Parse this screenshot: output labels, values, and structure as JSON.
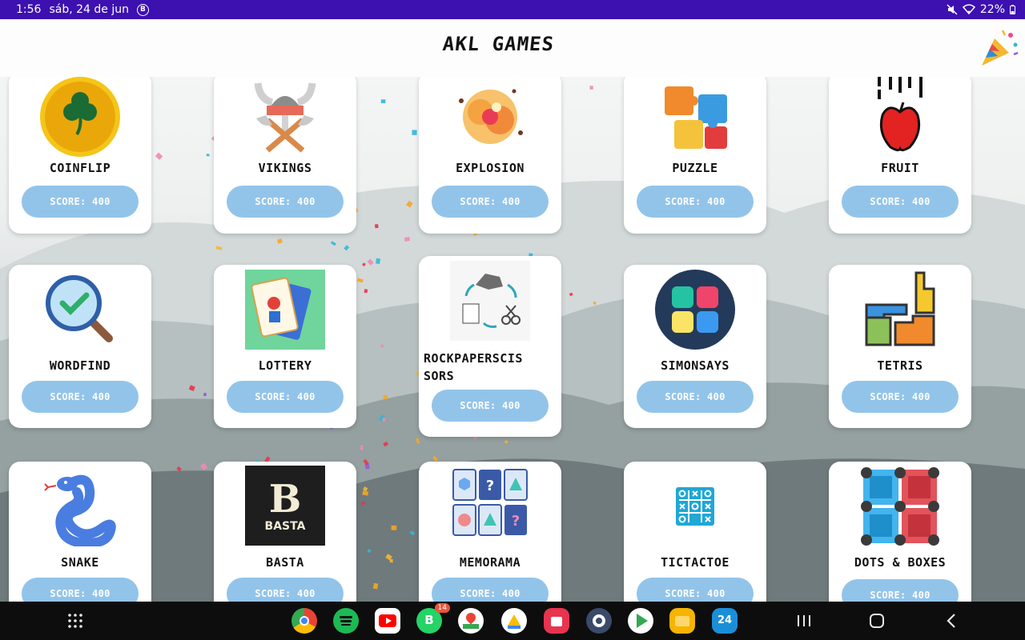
{
  "status_bar": {
    "time": "1:56",
    "date": "sáb, 24 de jun",
    "notif_letter": "B",
    "battery": "22%"
  },
  "app": {
    "title": "AKL GAMES"
  },
  "colors": {
    "status_bar_bg": "#3d10b0",
    "score_button_bg": "#92c4ea",
    "card_bg": "#ffffff"
  },
  "games": [
    {
      "name": "COINFLIP",
      "score": "SCORE: 400",
      "icon": "clover-coin-icon"
    },
    {
      "name": "VIKINGS",
      "score": "SCORE: 400",
      "icon": "viking-helmet-icon"
    },
    {
      "name": "EXPLOSION",
      "score": "SCORE: 400",
      "icon": "explosion-icon"
    },
    {
      "name": "PUZZLE",
      "score": "SCORE: 400",
      "icon": "puzzle-pieces-icon"
    },
    {
      "name": "FRUIT",
      "score": "SCORE: 400",
      "icon": "falling-apple-icon"
    },
    {
      "name": "WORDFIND",
      "score": "SCORE: 400",
      "icon": "magnifier-check-icon"
    },
    {
      "name": "LOTTERY",
      "score": "SCORE: 400",
      "icon": "lottery-cards-icon"
    },
    {
      "name": "ROCKPAPERSCIS\nSORS",
      "score": "SCORE: 400",
      "icon": "rock-paper-scissors-icon"
    },
    {
      "name": "SIMONSAYS",
      "score": "SCORE: 400",
      "icon": "simon-buttons-icon"
    },
    {
      "name": "TETRIS",
      "score": "SCORE: 400",
      "icon": "tetris-blocks-icon"
    },
    {
      "name": "SNAKE",
      "score": "SCORE: 400",
      "icon": "snake-icon"
    },
    {
      "name": "BASTA",
      "score": "SCORE: 400",
      "icon": "basta-logo-icon",
      "logo_letter": "B",
      "logo_text": "BASTA"
    },
    {
      "name": "MEMORAMA",
      "score": "SCORE: 400",
      "icon": "memory-cards-icon",
      "card_marks": [
        "?",
        "?"
      ]
    },
    {
      "name": "TICTACTOE",
      "score": "SCORE: 400",
      "icon": "tictactoe-grid-icon"
    },
    {
      "name": "DOTS & BOXES",
      "score": "SCORE: 400",
      "icon": "dots-boxes-icon"
    }
  ],
  "nav_bar": {
    "apps": [
      "chrome-icon",
      "spotify-icon",
      "youtube-icon",
      "whatsapp-business-icon",
      "maps-icon",
      "drive-icon",
      "galaxy-store-icon",
      "settings-icon",
      "play-store-icon",
      "files-icon",
      "calendar-icon"
    ],
    "whatsapp_badge": "14",
    "calendar_day": "24"
  }
}
